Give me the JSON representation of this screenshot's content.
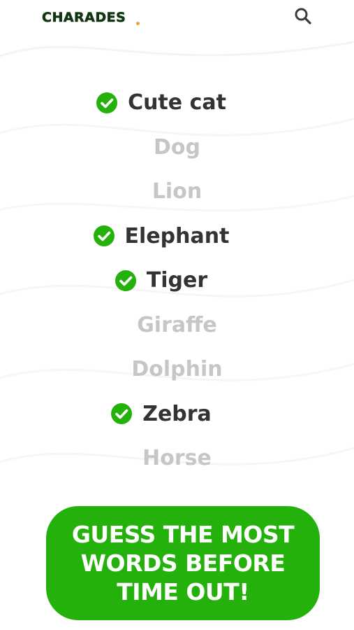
{
  "app": {
    "logo_text": "CHARADES",
    "brand_color": "#25b10b",
    "accent_dot_color": "#f0a030",
    "search_icon": "search-icon"
  },
  "words": [
    {
      "text": "Cute cat",
      "guessed": true
    },
    {
      "text": "Dog",
      "guessed": false
    },
    {
      "text": "Lion",
      "guessed": false
    },
    {
      "text": "Elephant",
      "guessed": true
    },
    {
      "text": "Tiger",
      "guessed": true
    },
    {
      "text": "Giraffe",
      "guessed": false
    },
    {
      "text": "Dolphin",
      "guessed": false
    },
    {
      "text": "Zebra",
      "guessed": true
    },
    {
      "text": "Horse",
      "guessed": false
    }
  ],
  "cta": {
    "label": "GUESS THE MOST WORDS BEFORE TIME OUT!",
    "color": "#25b10b"
  }
}
